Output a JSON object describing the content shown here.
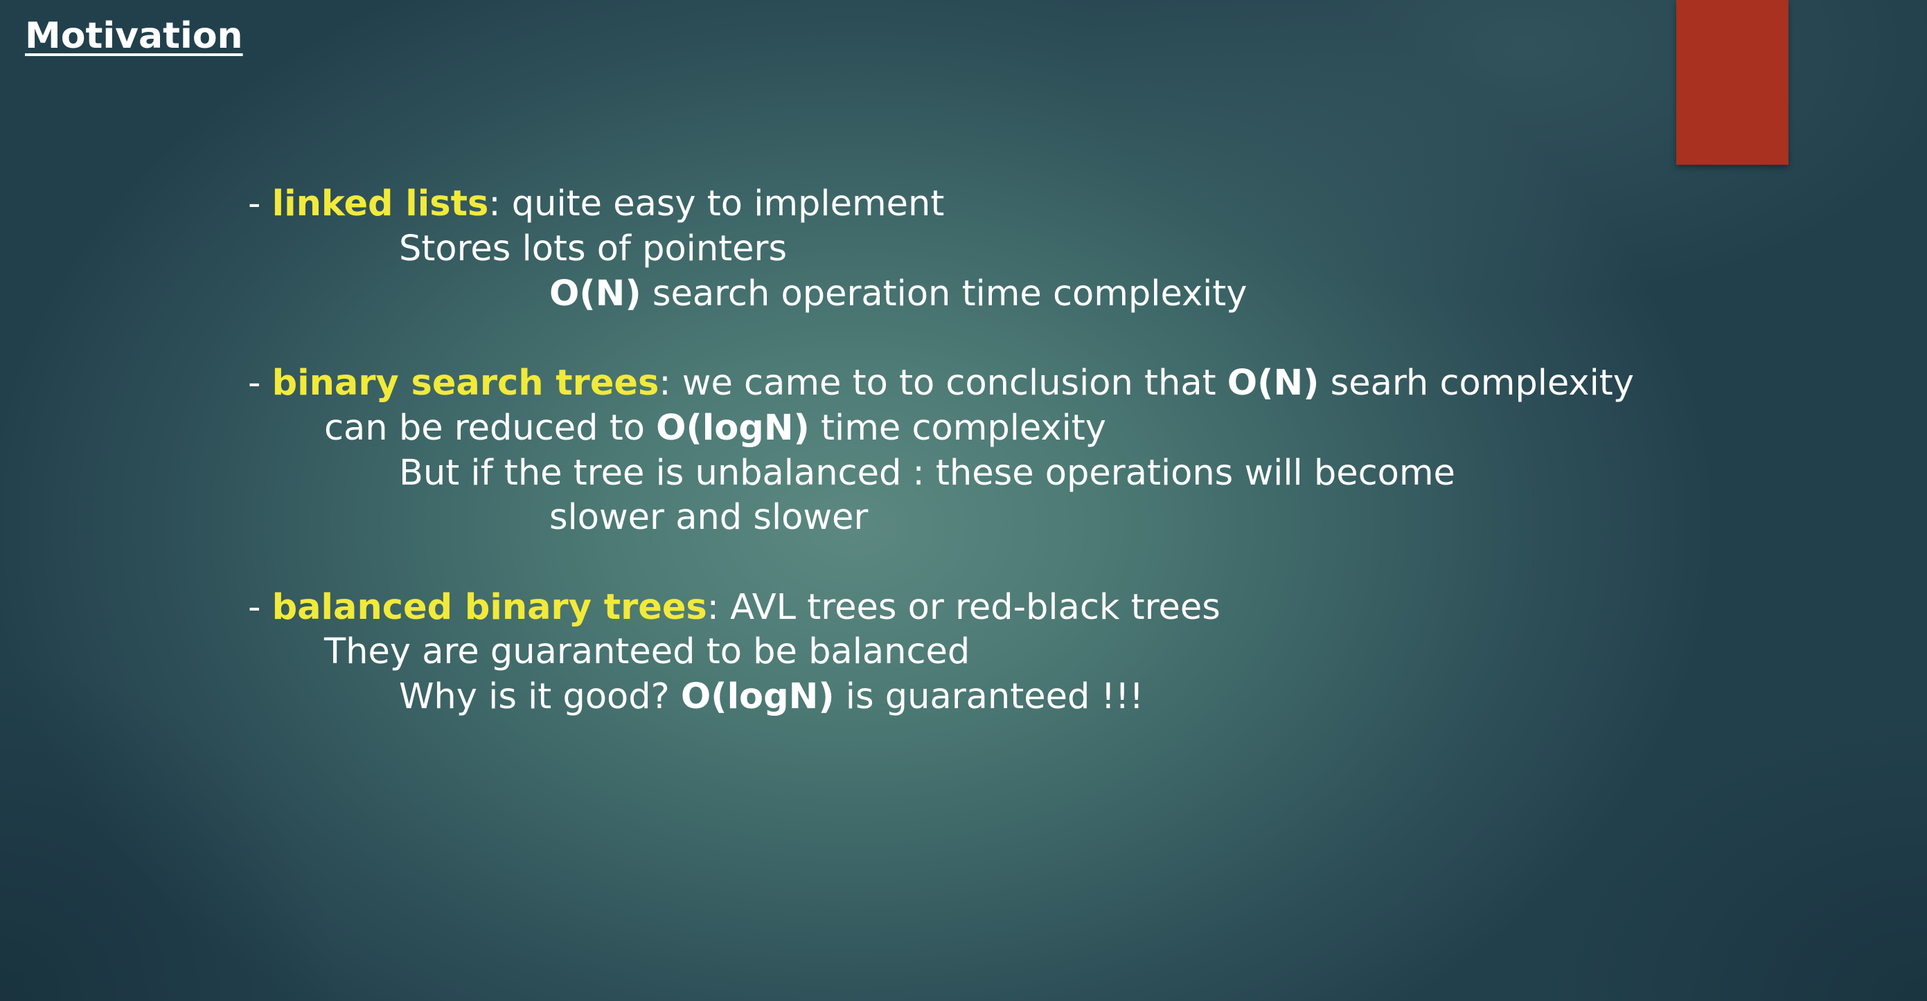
{
  "slide": {
    "title": "Motivation",
    "accent_color": "#a8311f",
    "highlight_color": "#f2ea3a"
  },
  "linked_lists": {
    "dash": "- ",
    "term": "linked lists",
    "desc": ": quite easy to implement",
    "line2": "Stores lots of pointers",
    "line3_bold": "O(N)",
    "line3_rest": " search operation time complexity"
  },
  "bst": {
    "dash": "- ",
    "term": "binary search trees",
    "desc": ": we came to to conclusion that ",
    "desc_bold": "O(N)",
    "desc_end": " searh complexity",
    "line2_start": "can be reduced to ",
    "line2_bold": "O(logN)",
    "line2_end": " time complexity",
    "line3": "But if the tree is unbalanced : these operations will become",
    "line4": "slower and slower"
  },
  "balanced": {
    "dash": "- ",
    "term": "balanced binary trees",
    "desc": ": AVL trees or red-black trees",
    "line2": "They are guaranteed to be balanced",
    "line3_start": "Why is it good? ",
    "line3_bold": "O(logN)",
    "line3_end": " is guaranteed !!!"
  }
}
